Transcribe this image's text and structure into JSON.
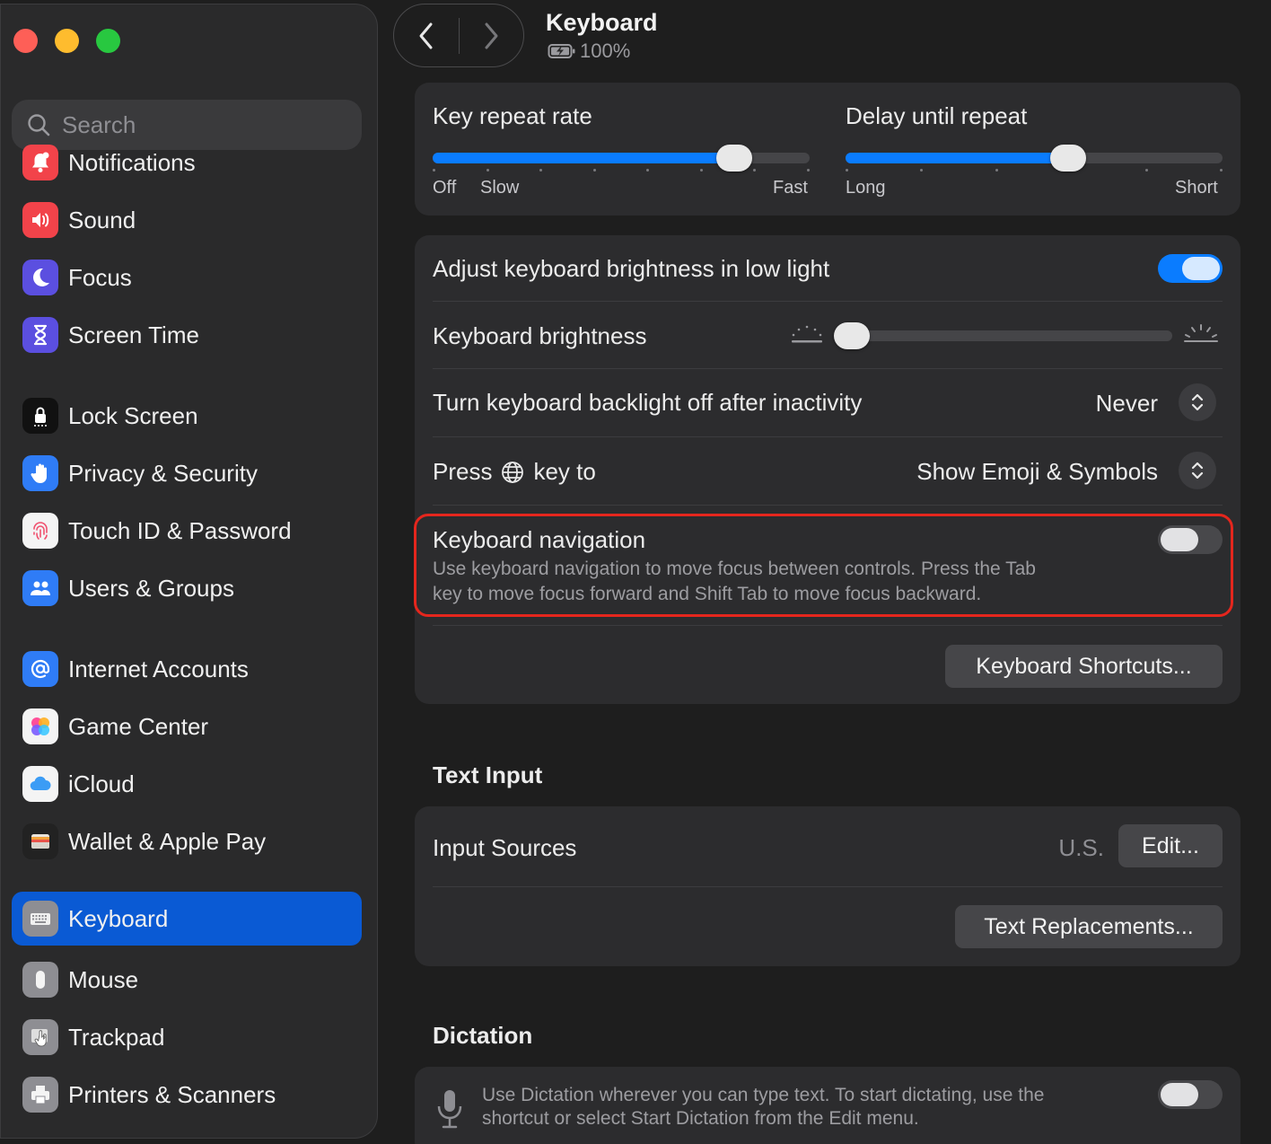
{
  "header": {
    "title": "Keyboard",
    "battery_text": "100%"
  },
  "sidebar": {
    "search_placeholder": "Search",
    "items": [
      {
        "label": "Notifications",
        "icon": "bell-icon",
        "color": "#f2434a"
      },
      {
        "label": "Sound",
        "icon": "speaker-icon",
        "color": "#f2434a"
      },
      {
        "label": "Focus",
        "icon": "moon-icon",
        "color": "#5b4fe0"
      },
      {
        "label": "Screen Time",
        "icon": "hourglass-icon",
        "color": "#5b4fe0"
      },
      {
        "label": "Lock Screen",
        "icon": "lock-icon",
        "color": "#111111"
      },
      {
        "label": "Privacy & Security",
        "icon": "hand-icon",
        "color": "#2f7cf6"
      },
      {
        "label": "Touch ID & Password",
        "icon": "fingerprint-icon",
        "color": "#f4f4f4"
      },
      {
        "label": "Users & Groups",
        "icon": "users-icon",
        "color": "#2f7cf6"
      },
      {
        "label": "Internet Accounts",
        "icon": "at-icon",
        "color": "#2f7cf6"
      },
      {
        "label": "Game Center",
        "icon": "game-center-icon",
        "color": "#f4f4f4"
      },
      {
        "label": "iCloud",
        "icon": "cloud-icon",
        "color": "#f4f4f4"
      },
      {
        "label": "Wallet & Apple Pay",
        "icon": "wallet-icon",
        "color": "#222222"
      },
      {
        "label": "Keyboard",
        "icon": "keyboard-icon",
        "color": "#8e8e93",
        "selected": true
      },
      {
        "label": "Mouse",
        "icon": "mouse-icon",
        "color": "#8e8e93"
      },
      {
        "label": "Trackpad",
        "icon": "trackpad-icon",
        "color": "#8e8e93"
      },
      {
        "label": "Printers & Scanners",
        "icon": "printer-icon",
        "color": "#8e8e93"
      }
    ]
  },
  "repeat": {
    "key_repeat_label": "Key repeat rate",
    "key_repeat_value": 0.8,
    "key_repeat_off": "Off",
    "key_repeat_slow": "Slow",
    "key_repeat_fast": "Fast",
    "delay_label": "Delay until repeat",
    "delay_value": 0.59,
    "delay_long": "Long",
    "delay_short": "Short"
  },
  "settings": {
    "adjust_brightness_label": "Adjust keyboard brightness in low light",
    "adjust_brightness_on": true,
    "brightness_label": "Keyboard brightness",
    "brightness_value": 0.05,
    "backlight_label": "Turn keyboard backlight off after inactivity",
    "backlight_value": "Never",
    "press_label_pre": "Press",
    "press_label_post": "key to",
    "press_value": "Show Emoji & Symbols",
    "nav_label": "Keyboard navigation",
    "nav_desc_1": "Use keyboard navigation to move focus between controls. Press the Tab",
    "nav_desc_2": "key to move focus forward and Shift Tab to move focus backward.",
    "nav_on": false,
    "shortcuts_button": "Keyboard Shortcuts..."
  },
  "text_input": {
    "section_title": "Text Input",
    "input_sources_label": "Input Sources",
    "input_sources_value": "U.S.",
    "edit_button": "Edit...",
    "replacements_button": "Text Replacements..."
  },
  "dictation": {
    "section_title": "Dictation",
    "desc_1": "Use Dictation wherever you can type text. To start dictating, use the",
    "desc_2": "shortcut or select Start Dictation from the Edit menu.",
    "on": false
  },
  "colors": {
    "accent": "#0a7cff",
    "selection": "#0a5ad4",
    "highlight_box": "#e5261d"
  }
}
